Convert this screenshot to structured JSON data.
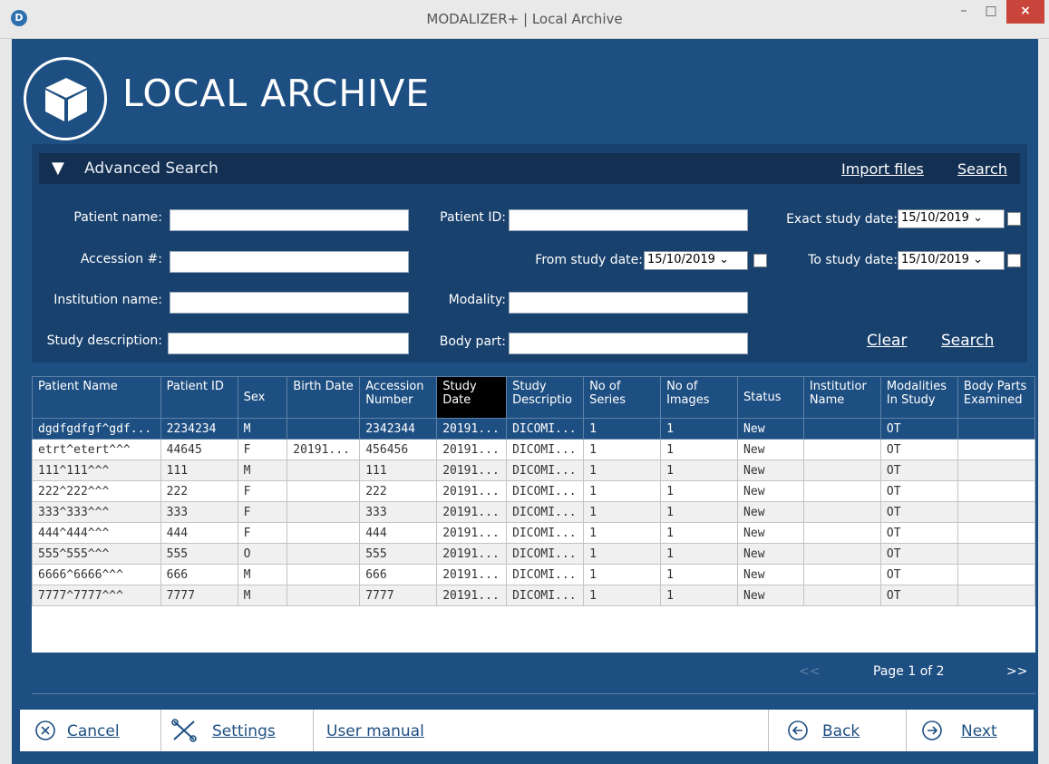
{
  "window": {
    "title": "MODALIZER+ | Local Archive",
    "app_icon": "D"
  },
  "header": {
    "title": "LOCAL ARCHIVE"
  },
  "advanced_search": {
    "title": "Advanced Search",
    "import_files": "Import files",
    "search_top": "Search",
    "patient_name_label": "Patient name:",
    "accession_label": "Accession #:",
    "institution_label": "Institution name:",
    "study_desc_label": "Study description:",
    "patient_id_label": "Patient ID:",
    "from_date_label": "From study date:",
    "from_date_value": "15/10/2019",
    "modality_label": "Modality:",
    "body_part_label": "Body part:",
    "exact_date_label": "Exact study date:",
    "exact_date_value": "15/10/2019",
    "to_date_label": "To study date:",
    "to_date_value": "15/10/2019",
    "clear": "Clear",
    "search": "Search"
  },
  "table": {
    "columns": [
      "Patient Name",
      "Patient ID",
      "Sex",
      "Birth Date",
      "Accession Number",
      "Study Date",
      "Study Descriptio",
      "No of Series",
      "No of Images",
      "Status",
      "Institutior Name",
      "Modalities In Study",
      "Body Parts Examined"
    ],
    "rows": [
      [
        "dgdfgdfgf^gdf...",
        "2234234",
        "M",
        "",
        "2342344",
        "20191...",
        "DICOMI...",
        "1",
        "1",
        "New",
        "",
        "OT",
        ""
      ],
      [
        "etrt^etert^^^",
        "44645",
        "F",
        "20191...",
        "456456",
        "20191...",
        "DICOMI...",
        "1",
        "1",
        "New",
        "",
        "OT",
        ""
      ],
      [
        "111^111^^^",
        "111",
        "M",
        "",
        "111",
        "20191...",
        "DICOMI...",
        "1",
        "1",
        "New",
        "",
        "OT",
        ""
      ],
      [
        "222^222^^^",
        "222",
        "F",
        "",
        "222",
        "20191...",
        "DICOMI...",
        "1",
        "1",
        "New",
        "",
        "OT",
        ""
      ],
      [
        "333^333^^^",
        "333",
        "F",
        "",
        "333",
        "20191...",
        "DICOMI...",
        "1",
        "1",
        "New",
        "",
        "OT",
        ""
      ],
      [
        "444^444^^^",
        "444",
        "F",
        "",
        "444",
        "20191...",
        "DICOMI...",
        "1",
        "1",
        "New",
        "",
        "OT",
        ""
      ],
      [
        "555^555^^^",
        "555",
        "O",
        "",
        "555",
        "20191...",
        "DICOMI...",
        "1",
        "1",
        "New",
        "",
        "OT",
        ""
      ],
      [
        "6666^6666^^^",
        "666",
        "M",
        "",
        "666",
        "20191...",
        "DICOMI...",
        "1",
        "1",
        "New",
        "",
        "OT",
        ""
      ],
      [
        "7777^7777^^^",
        "7777",
        "M",
        "",
        "7777",
        "20191...",
        "DICOMI...",
        "1",
        "1",
        "New",
        "",
        "OT",
        ""
      ]
    ]
  },
  "pagination": {
    "prev": "<<",
    "info": "Page 1 of 2",
    "next": ">>"
  },
  "bottom": {
    "cancel": "Cancel",
    "settings": "Settings",
    "manual": "User manual",
    "back": "Back",
    "next": "Next"
  },
  "colors": {
    "brand_blue": "#1e4f82",
    "panel_blue": "#19416d",
    "close_red": "#c9453b"
  }
}
